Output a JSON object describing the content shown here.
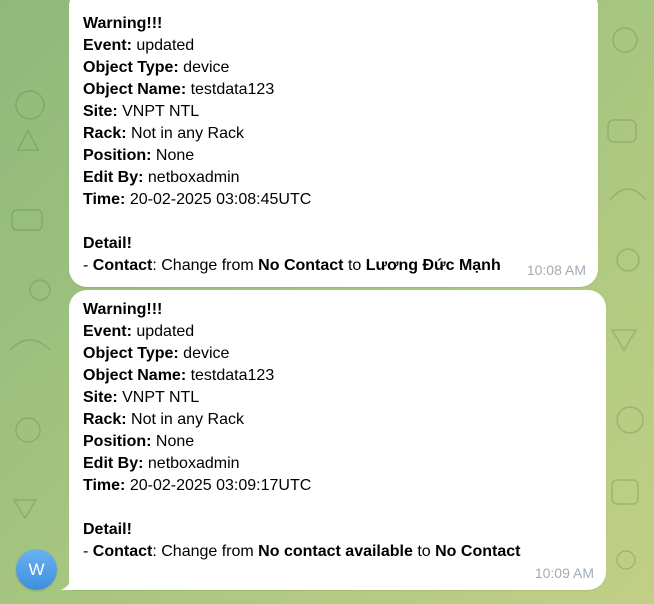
{
  "theme": {
    "bubble_color": "#ffffff",
    "time_color": "#a0acb6",
    "avatar_color": "#4a9fe6"
  },
  "avatar": {
    "initial": "W",
    "icon": "user-avatar"
  },
  "messages": [
    {
      "warning": "Warning!!!",
      "event_label": "Event:",
      "event_value": " updated",
      "object_type_label": "Object Type:",
      "object_type_value": " device",
      "object_name_label": "Object Name:",
      "object_name_value": " testdata123",
      "site_label": "Site:",
      "site_value": " VNPT NTL",
      "rack_label": "Rack:",
      "rack_value": " Not in any Rack",
      "position_label": "Position:",
      "position_value": " None",
      "edit_by_label": "Edit By:",
      "edit_by_value": " netboxadmin",
      "time_label": "Time:",
      "time_value": " 20-02-2025 03:08:45UTC",
      "detail_heading": "Detail!",
      "detail_prefix": "- ",
      "detail_field": "Contact",
      "detail_mid": ": Change from ",
      "detail_from": "No Contact",
      "detail_to_word": " to ",
      "detail_to": "Lương Đức Mạnh",
      "timestamp": "10:08 AM"
    },
    {
      "warning": "Warning!!!",
      "event_label": "Event:",
      "event_value": " updated",
      "object_type_label": "Object Type:",
      "object_type_value": " device",
      "object_name_label": "Object Name:",
      "object_name_value": " testdata123",
      "site_label": "Site:",
      "site_value": " VNPT NTL",
      "rack_label": "Rack:",
      "rack_value": " Not in any Rack",
      "position_label": "Position:",
      "position_value": " None",
      "edit_by_label": "Edit By:",
      "edit_by_value": " netboxadmin",
      "time_label": "Time:",
      "time_value": " 20-02-2025 03:09:17UTC",
      "detail_heading": "Detail!",
      "detail_prefix": "- ",
      "detail_field": "Contact",
      "detail_mid": ": Change from ",
      "detail_from": "No contact available",
      "detail_to_word": " to ",
      "detail_to": "No Contact",
      "timestamp": "10:09 AM"
    }
  ]
}
